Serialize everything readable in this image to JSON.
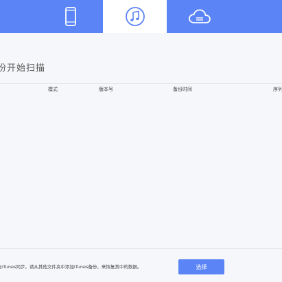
{
  "tabs": [
    {
      "icon": "phone-icon",
      "active": false
    },
    {
      "icon": "itunes-music-icon",
      "active": true
    },
    {
      "icon": "icloud-icon",
      "active": false
    }
  ],
  "heading": "份开始扫描",
  "table": {
    "columns": [
      "模式",
      "版本号",
      "备份时间",
      "序列"
    ]
  },
  "footer": {
    "text": "备与iTunes同步。请从其他文件夹中添加iTunes备份，来恢复其中的数据。",
    "select_label": "选择"
  },
  "colors": {
    "accent": "#5b84f6",
    "background": "#f5f7fa",
    "border": "#e3e6ec"
  }
}
